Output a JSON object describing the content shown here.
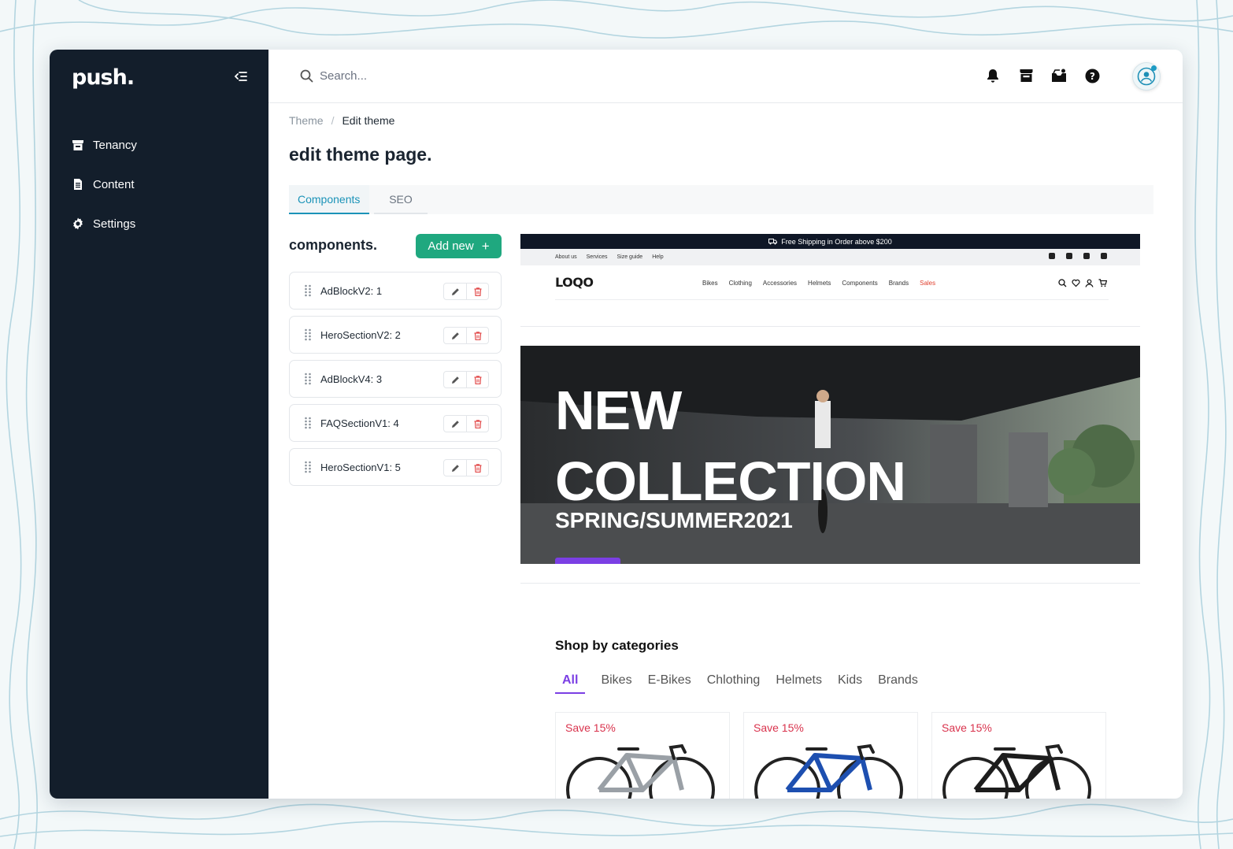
{
  "app": {
    "logo": "push."
  },
  "sidebar": {
    "items": [
      {
        "label": "Tenancy",
        "icon": "store-icon"
      },
      {
        "label": "Content",
        "icon": "document-icon"
      },
      {
        "label": "Settings",
        "icon": "gear-icon"
      }
    ]
  },
  "topbar": {
    "search_placeholder": "Search...",
    "icons": [
      "bell-icon",
      "store-icon",
      "inbox-icon",
      "help-icon"
    ]
  },
  "breadcrumb": {
    "parent": "Theme",
    "current": "Edit theme"
  },
  "page": {
    "title": "edit theme page."
  },
  "tabs": [
    {
      "label": "Components",
      "active": true
    },
    {
      "label": "SEO",
      "active": false
    }
  ],
  "components": {
    "title": "components.",
    "add_label": "Add new",
    "items": [
      {
        "label": "AdBlockV2: 1"
      },
      {
        "label": "HeroSectionV2: 2"
      },
      {
        "label": "AdBlockV4: 3"
      },
      {
        "label": "FAQSectionV1: 4"
      },
      {
        "label": "HeroSectionV1: 5"
      }
    ]
  },
  "preview": {
    "shipping": "Free Shipping in Order above $200",
    "util_links": [
      "About us",
      "Services",
      "Size guide",
      "Help"
    ],
    "brand": "LOQO",
    "menu": [
      "Bikes",
      "Clothing",
      "Accessories",
      "Helmets",
      "Components",
      "Brands",
      "Sales"
    ],
    "hero": {
      "line1": "NEW",
      "line2": "COLLECTION",
      "line3": "SPRING/SUMMER2021"
    },
    "categories_title": "Shop by categories",
    "category_tabs": [
      "All",
      "Bikes",
      "E-Bikes",
      "Chlothing",
      "Helmets",
      "Kids",
      "Brands"
    ],
    "cards": [
      {
        "badge": "Save 15%",
        "frame_color": "#9aa0a6"
      },
      {
        "badge": "Save 15%",
        "frame_color": "#1d4fb0"
      },
      {
        "badge": "Save 15%",
        "frame_color": "#1c1c1c"
      }
    ]
  },
  "colors": {
    "sidebar": "#131e2b",
    "accent": "#1b93b8",
    "primary_button": "#1fa87f",
    "delete": "#e24b4b"
  }
}
